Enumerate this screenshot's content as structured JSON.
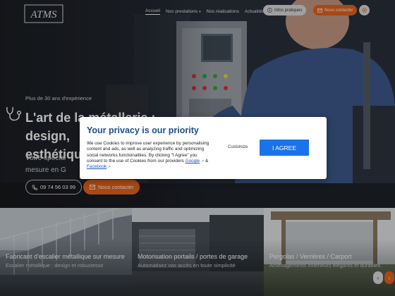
{
  "header": {
    "logo_text": "ATMS",
    "nav": [
      {
        "label": "Accueil",
        "active": true,
        "dropdown": false
      },
      {
        "label": "Nos prestations",
        "active": false,
        "dropdown": true
      },
      {
        "label": "Nos réalisations",
        "active": false,
        "dropdown": false
      },
      {
        "label": "Actualités",
        "active": false,
        "dropdown": false
      }
    ],
    "info_button": "Infos pratiques",
    "contact_button": "Nous contacter",
    "settings_icon": "gear-icon"
  },
  "hero": {
    "experience": "Plus de 30 ans d'expérience",
    "headline_line1": "L'art de la métallerie : design,",
    "headline_line2": "esthétique",
    "subtext_line1": "Votre spécial",
    "subtext_line2": "mesure en G",
    "phone": "09 74 56 03 99",
    "contact_button": "Nous contacter"
  },
  "cookie_modal": {
    "title": "Your privacy is our priority",
    "body_text": "We use Cookies to improve user experience by personalising content and ads, as well as analyzing traffic and optimizing social networks functionalities. By clicking \"I Agree\" you consent to the use of Cookies from our providers",
    "link_google": "Google",
    "link_and": "&",
    "link_facebook": "Facebook",
    "customize": "Customize",
    "agree": "I AGREE"
  },
  "cards": [
    {
      "title": "Fabricant d'escalier métallique sur mesure",
      "description": "Escalier métallique : design et robustesse"
    },
    {
      "title": "Motorisation portails / portes de garage",
      "description": "Automatisez vos accès en toute simplicité"
    },
    {
      "title": "Pergolas / Verrières / Carport",
      "description": "Aménagements extérieurs élégants et durables"
    }
  ],
  "colors": {
    "accent_orange": "#e8641e",
    "privacy_title_blue": "#1e4e8c",
    "agree_blue": "#1a73e8"
  }
}
